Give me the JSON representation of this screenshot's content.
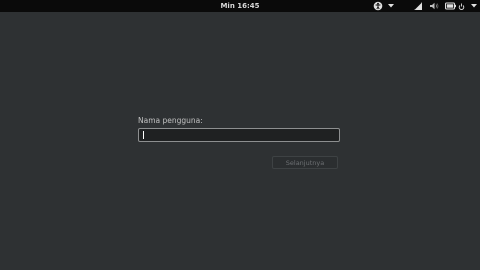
{
  "topbar": {
    "clock": "Min 16:45",
    "icons": [
      "accessibility-icon",
      "chevron-down-icon",
      "network-icon",
      "volume-icon",
      "battery-icon",
      "power-icon",
      "chevron-down-icon"
    ]
  },
  "login": {
    "username_label": "Nama pengguna:",
    "username_value": "",
    "next_button_label": "Selanjutnya"
  },
  "colors": {
    "background": "#2e3133",
    "topbar": "#0a0a0a",
    "input_background": "#1f2122",
    "input_border": "#8d8f90"
  }
}
